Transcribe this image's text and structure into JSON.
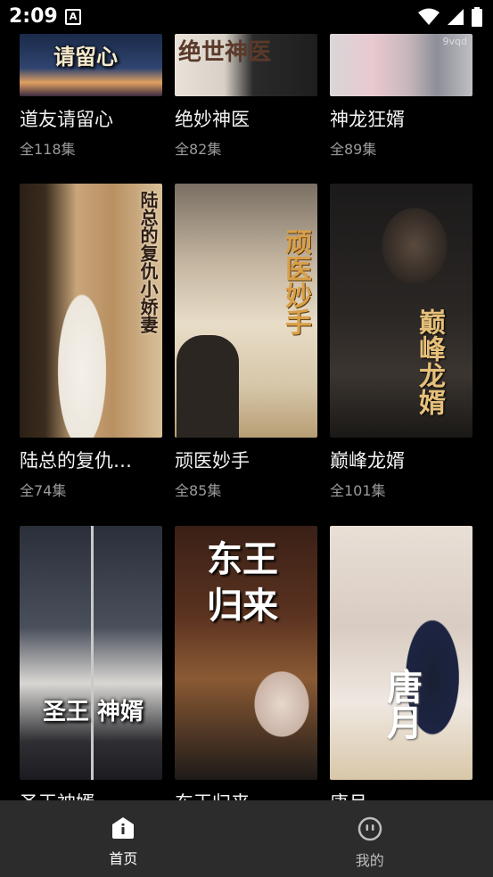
{
  "status_bar": {
    "time": "2:09",
    "notif_glyph": "A",
    "icons": [
      "wifi-icon",
      "cell-signal-icon",
      "battery-icon"
    ]
  },
  "feed": {
    "rows": [
      [
        {
          "title": "道友请留心",
          "episodes": "全118集",
          "poster_caption": "请留心"
        },
        {
          "title": "绝妙神医",
          "episodes": "全82集",
          "poster_caption": "绝世神医"
        },
        {
          "title": "神龙狂婿",
          "episodes": "全89集",
          "poster_badge": "9vqd"
        }
      ],
      [
        {
          "title": "陆总的复仇…",
          "episodes": "全74集",
          "poster_caption": "陆总的复仇小娇妻"
        },
        {
          "title": "顽医妙手",
          "episodes": "全85集",
          "poster_caption": "顽医妙手"
        },
        {
          "title": "巅峰龙婿",
          "episodes": "全101集",
          "poster_caption": "巅峰龙婿"
        }
      ],
      [
        {
          "title": "圣王神婿",
          "episodes": "",
          "poster_caption": "圣王 神婿"
        },
        {
          "title": "东王归来",
          "episodes": "",
          "poster_caption": "东王归来"
        },
        {
          "title": "唐月",
          "episodes": "",
          "poster_caption": "唐月"
        }
      ]
    ]
  },
  "bottom_nav": {
    "home": {
      "label": "首页",
      "icon": "home-icon"
    },
    "mine": {
      "label": "我的",
      "icon": "face-icon"
    }
  },
  "colors": {
    "background": "#000000",
    "nav_bar": "#2c2c2c",
    "muted_text": "#9a9a9a"
  }
}
